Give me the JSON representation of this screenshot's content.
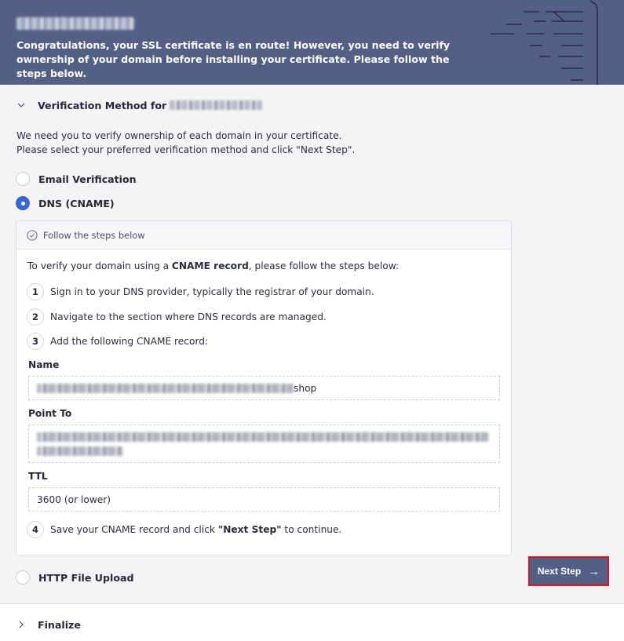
{
  "banner": {
    "domain": "████████████",
    "message": "Congratulations, your SSL certificate is en route! However, you need to verify ownership of your domain before installing your certificate. Please follow the steps below."
  },
  "verification": {
    "title": "Verification Method for",
    "domain": "████████████",
    "intro_line1": "We need you to verify ownership of each domain in your certificate.",
    "intro_line2": "Please select your preferred verification method and click \"Next Step\".",
    "options": [
      {
        "label": "Email Verification",
        "selected": false
      },
      {
        "label": "DNS (CNAME)",
        "selected": true
      },
      {
        "label": "HTTP File Upload",
        "selected": false
      }
    ],
    "steps_header": "Follow the steps below",
    "lead_prefix": "To verify your domain using a ",
    "lead_bold": "CNAME record",
    "lead_suffix": ", please follow the steps below:",
    "steps": [
      {
        "num": "1",
        "text": "Sign in to your DNS provider, typically the registrar of your domain."
      },
      {
        "num": "2",
        "text": "Navigate to the section where DNS records are managed."
      },
      {
        "num": "3",
        "text": "Add the following CNAME record:"
      }
    ],
    "step4": {
      "num": "4",
      "prefix": "Save your CNAME record and click ",
      "bold": "\"Next Step\"",
      "suffix": " to continue."
    },
    "name_label": "Name",
    "name_value_suffix": "shop",
    "point_to_label": "Point To",
    "ttl_label": "TTL",
    "ttl_value": "3600 (or lower)"
  },
  "next_button": {
    "label": "Next Step",
    "arrow": "→"
  },
  "finalize": {
    "title": "Finalize"
  },
  "colors": {
    "banner": "#545f85",
    "accent": "#3a65d8",
    "highlight": "#e0151d"
  }
}
